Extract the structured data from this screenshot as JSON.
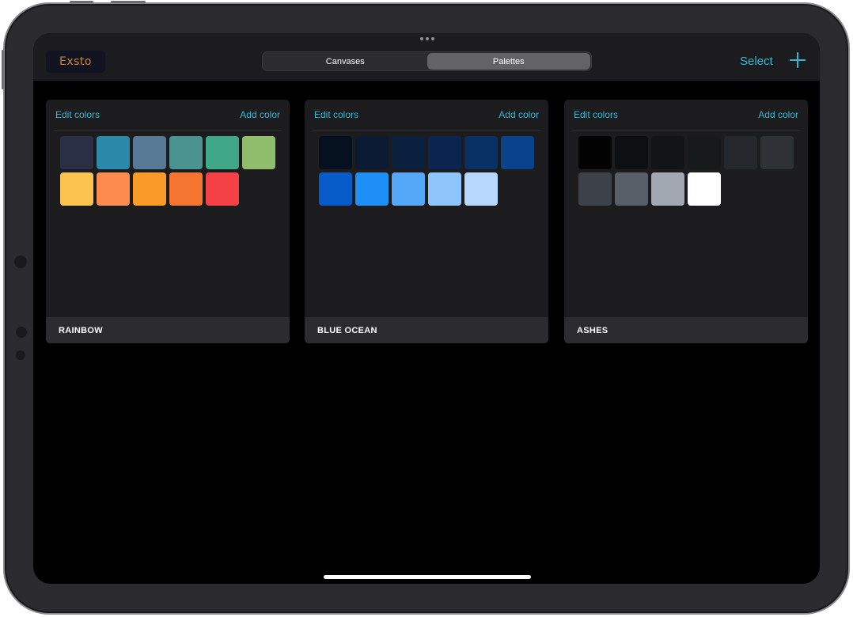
{
  "nav": {
    "logo": "Exsto",
    "tabs": [
      {
        "label": "Canvases",
        "active": false
      },
      {
        "label": "Palettes",
        "active": true
      }
    ],
    "select_label": "Select",
    "accent": "#2fb9d6"
  },
  "palettes": [
    {
      "name": "RAINBOW",
      "edit_label": "Edit colors",
      "add_label": "Add color",
      "colors": [
        "#2a2f45",
        "#2a88a8",
        "#567a94",
        "#4a9390",
        "#40a887",
        "#8fbd6c",
        "#fdc350",
        "#fb8b4e",
        "#f99b26",
        "#f3752f",
        "#f44146"
      ]
    },
    {
      "name": "BLUE OCEAN",
      "edit_label": "Edit colors",
      "add_label": "Add color",
      "colors": [
        "#061120",
        "#0a1b33",
        "#0b1f3f",
        "#0b2550",
        "#083064",
        "#0a428c",
        "#065bc9",
        "#1e8ff4",
        "#54a8f7",
        "#8ec6fb",
        "#b7d7fc"
      ]
    },
    {
      "name": "ASHES",
      "edit_label": "Edit colors",
      "add_label": "Add color",
      "colors": [
        "#020202",
        "#0d0f11",
        "#121416",
        "#17191b",
        "#24272b",
        "#2e3236",
        "#3c4248",
        "#575e68",
        "#a2a8b2",
        "#ffffff"
      ]
    }
  ]
}
